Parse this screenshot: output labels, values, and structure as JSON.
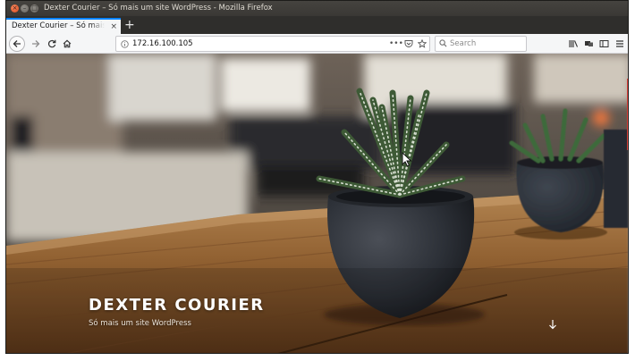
{
  "window": {
    "title": "Dexter Courier – Só mais um site WordPress - Mozilla Firefox",
    "controls": {
      "close": "×",
      "minimize": "–",
      "maximize": "□"
    }
  },
  "tabs": [
    {
      "label": "Dexter Courier – Só mais um site WordPress",
      "active": true,
      "close": "×"
    }
  ],
  "tabstrip": {
    "new_tab": "+"
  },
  "navbar": {
    "back_icon": "arrow-left-icon",
    "forward_icon": "arrow-right-icon",
    "reload_icon": "reload-icon",
    "home_icon": "home-icon",
    "url": "172.16.100.105",
    "page_actions": "•••",
    "search_placeholder": "Search"
  },
  "page": {
    "site_title": "DEXTER COURIER",
    "tagline": "Só mais um site WordPress",
    "scroll_icon": "arrow-down-icon"
  },
  "colors": {
    "accent": "#0a84ff",
    "titlebar": "#3c3b37",
    "close_button": "#e95420",
    "scrollbar_thumb": "#e0443e"
  }
}
